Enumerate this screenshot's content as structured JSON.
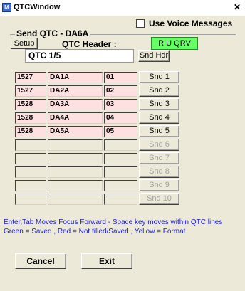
{
  "window": {
    "title": "QTCWindow",
    "icon_text": "M",
    "close_glyph": "✕"
  },
  "voice": {
    "checked": false,
    "label": "Use Voice Messages"
  },
  "send_group": {
    "title": "Send QTC - DA6A"
  },
  "header": {
    "setup_label": "Setup",
    "qtc_header_label": "QTC Header :",
    "rqrv_label": "R U QRV",
    "rqrv_color": "#66ff66",
    "qtc_value": "QTC 1/5",
    "snd_hdr_label": "Snd Hdr"
  },
  "rows": [
    {
      "time": "1527",
      "call": "DA1A",
      "nr": "01",
      "snd": "Snd 1"
    },
    {
      "time": "1527",
      "call": "DA2A",
      "nr": "02",
      "snd": "Snd 2"
    },
    {
      "time": "1528",
      "call": "DA3A",
      "nr": "03",
      "snd": "Snd 3"
    },
    {
      "time": "1528",
      "call": "DA4A",
      "nr": "04",
      "snd": "Snd 4"
    },
    {
      "time": "1528",
      "call": "DA5A",
      "nr": "05",
      "snd": "Snd 5"
    },
    {
      "time": "",
      "call": "",
      "nr": "",
      "snd": "Snd 6"
    },
    {
      "time": "",
      "call": "",
      "nr": "",
      "snd": "Snd 7"
    },
    {
      "time": "",
      "call": "",
      "nr": "",
      "snd": "Snd 8"
    },
    {
      "time": "",
      "call": "",
      "nr": "",
      "snd": "Snd 9"
    },
    {
      "time": "",
      "call": "",
      "nr": "",
      "snd": "Snd 10"
    }
  ],
  "info_text": "Enter,Tab Moves Focus Forward - Space key moves within QTC lines Green = Saved , Red = Not filled/Saved , Yellow = Format",
  "buttons": {
    "cancel": "Cancel",
    "exit": "Exit"
  },
  "colors": {
    "filled_row": "#ffe0e0",
    "info_text": "#1c1ccf"
  }
}
